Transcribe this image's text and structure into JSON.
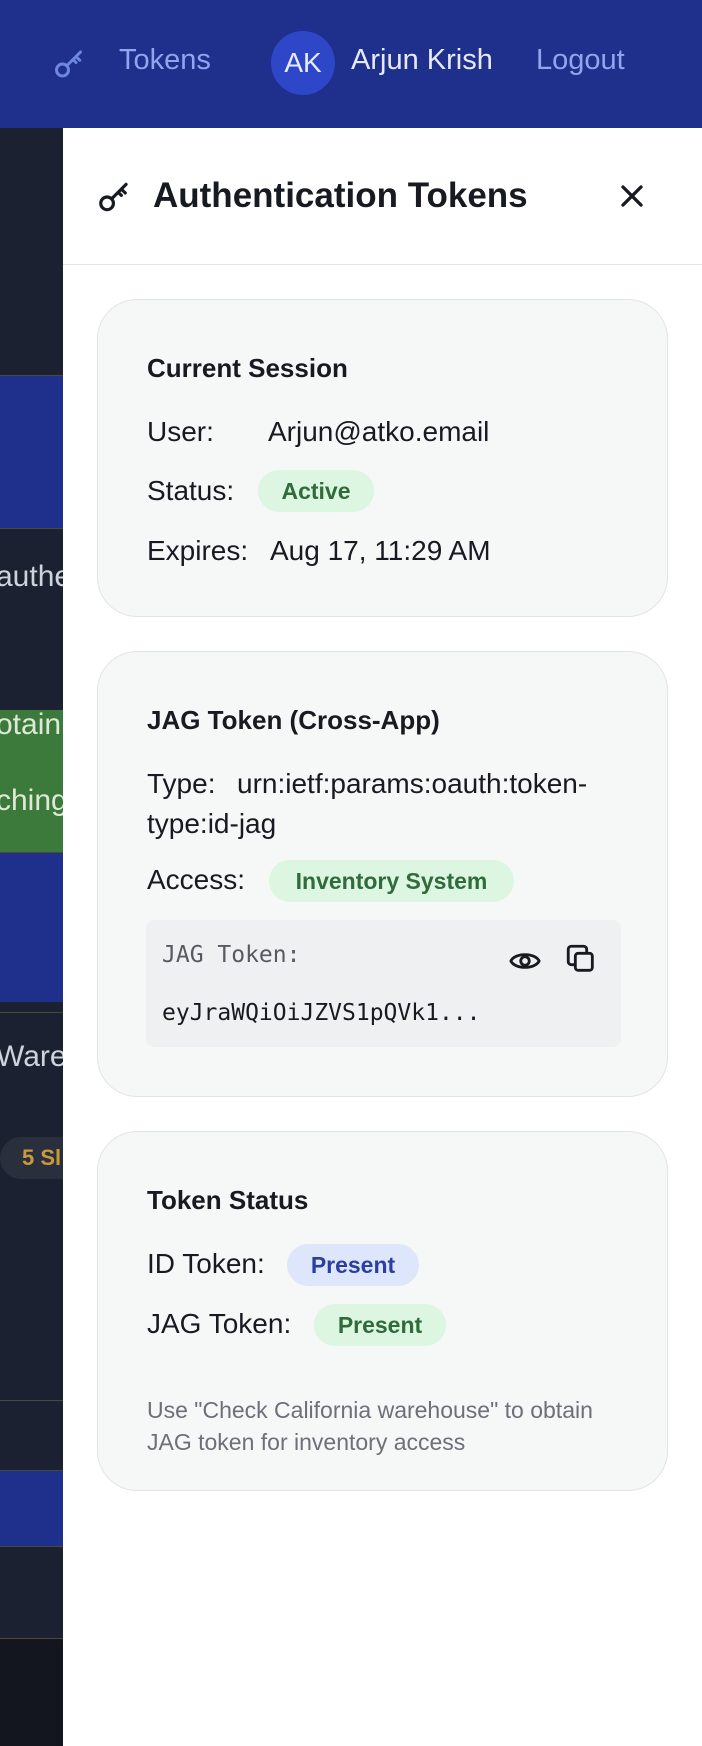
{
  "nav": {
    "tokens_label": "Tokens",
    "avatar_initials": "AK",
    "user_name": "Arjun Krish",
    "logout_label": "Logout"
  },
  "background": {
    "fragments": [
      "authe",
      "otain",
      "ching",
      "Wareh",
      "5 Sl"
    ]
  },
  "drawer": {
    "title": "Authentication Tokens",
    "current_session": {
      "title": "Current Session",
      "user_label": "User:",
      "user_value": "Arjun@atko.email",
      "status_label": "Status:",
      "status_value": "Active",
      "expires_label": "Expires:",
      "expires_value": "Aug 17, 11:29 AM"
    },
    "jag_token": {
      "title": "JAG Token (Cross-App)",
      "type_label": "Type:",
      "type_value_line1": "urn:ietf:params:oauth:token-",
      "type_value_line2": "type:id-jag",
      "access_label": "Access:",
      "access_value": "Inventory System",
      "token_box_label": "JAG Token:",
      "token_value": "eyJraWQiOiJZVS1pQVk1..."
    },
    "token_status": {
      "title": "Token Status",
      "id_token_label": "ID Token:",
      "id_token_value": "Present",
      "jag_token_label": "JAG Token:",
      "jag_token_value": "Present",
      "hint": "Use \"Check California warehouse\" to obtain JAG token for inventory access"
    }
  },
  "colors": {
    "nav_bg": "#1e2f8c",
    "avatar_bg": "#2e47c9",
    "pill_green_bg": "#dcf6e2",
    "pill_blue_bg": "#dde6fb"
  }
}
